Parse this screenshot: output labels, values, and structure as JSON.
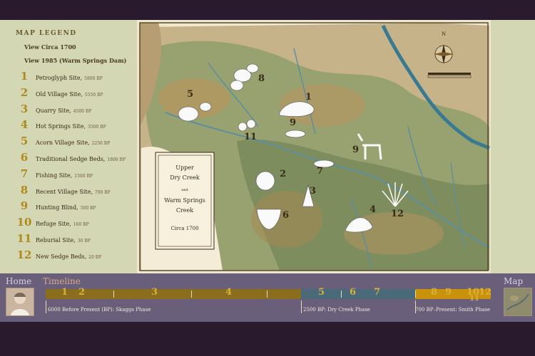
{
  "legend": {
    "title": "MAP LEGEND",
    "view_1700": "View Circa 1700",
    "view_1985": "View 1985 (Warm Springs Dam)",
    "items": [
      {
        "num": "1",
        "name": "Petroglyph Site,",
        "date": "5800 BP"
      },
      {
        "num": "2",
        "name": "Old Village Site,",
        "date": "5550 BP"
      },
      {
        "num": "3",
        "name": "Quarry Site,",
        "date": "4500 BP"
      },
      {
        "num": "4",
        "name": "Hot Springs Site,",
        "date": "3500 BP"
      },
      {
        "num": "5",
        "name": "Acorn Village Site,",
        "date": "2250 BP"
      },
      {
        "num": "6",
        "name": "Traditional Sedge Beds,",
        "date": "1800 BP"
      },
      {
        "num": "7",
        "name": "Fishing Site,",
        "date": "1500 BP"
      },
      {
        "num": "8",
        "name": "Recent Village Site,",
        "date": "700 BP"
      },
      {
        "num": "9",
        "name": "Hunting Blind,",
        "date": "500 BP"
      },
      {
        "num": "10",
        "name": "Refuge Site,",
        "date": "160 BP"
      },
      {
        "num": "11",
        "name": "Reburial Site,",
        "date": "30 BP"
      },
      {
        "num": "12",
        "name": "New Sedge Beds,",
        "date": "20 BP"
      }
    ]
  },
  "map": {
    "cartouche": [
      "Upper",
      "Dry Creek",
      "and",
      "Warm Springs",
      "Creek",
      "Circa 1700"
    ],
    "compass_n": "N"
  },
  "nav": {
    "home": "Home",
    "timeline": "Timeline",
    "map": "Map"
  },
  "timeline": {
    "marks": [
      "1",
      "2",
      "3",
      "4",
      "5",
      "6",
      "7",
      "8",
      "9",
      "10",
      "12",
      "11"
    ],
    "phases": [
      "6000 Before Present (BP): Skaggs Phase",
      "2500 BP: Dry Creek Phase",
      "700 BP–Present: Smith Phase"
    ]
  },
  "colors": {
    "accent_gold": "#b08a1c",
    "timeline_early": "#8a6e1e",
    "timeline_mid": "#4a6a7a",
    "timeline_late": "#c9920a",
    "panel": "#d3d7b3",
    "frame": "#2a1a2e",
    "river": "#3a7a90"
  }
}
